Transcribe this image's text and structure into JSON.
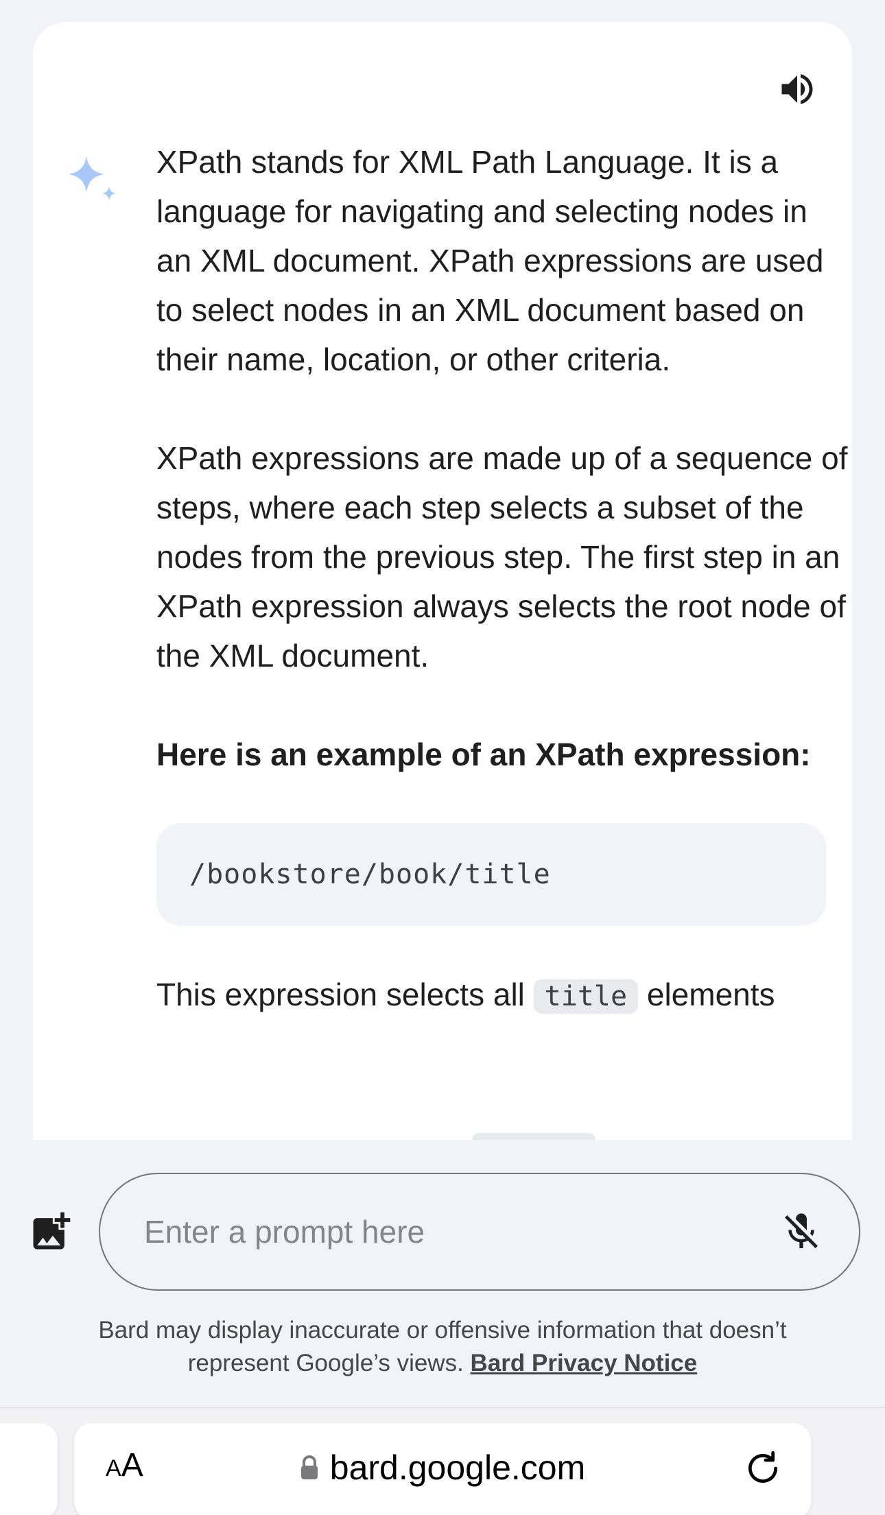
{
  "response": {
    "paragraphs": [
      "XPath stands for XML Path Language. It is a language for navigating and selecting nodes in an XML document. XPath expressions are used to select nodes in an XML document based on their name, location, or other criteria.",
      "XPath expressions are made up of a sequence of steps, where each step selects a subset of the nodes from the previous step. The first step in an XPath expression always selects the root node of the XML document."
    ],
    "heading": "Here is an example of an XPath expression:",
    "code_example": "/bookstore/book/title",
    "last_line_before": "This expression selects all ",
    "last_line_code": "title",
    "last_line_after": " elements"
  },
  "icons": {
    "speaker": "volume-icon",
    "sparkle": "bard-sparkle-icon",
    "add_image": "add-image-icon",
    "mic": "mic-off-icon",
    "lock": "lock-icon",
    "reload": "reload-icon"
  },
  "prompt": {
    "placeholder": "Enter a prompt here",
    "value": ""
  },
  "disclaimer": {
    "text_line1": "Bard may display inaccurate or offensive information that doesn’t",
    "text_line2": "represent Google’s views. ",
    "link": "Bard Privacy Notice"
  },
  "browser": {
    "aa_small": "A",
    "aa_big": "A",
    "url": "bard.google.com"
  },
  "colors": {
    "background": "#f0f4f9",
    "card": "#ffffff",
    "sparkle_blue": "#a8c7fa",
    "text": "#1f1f1f"
  }
}
